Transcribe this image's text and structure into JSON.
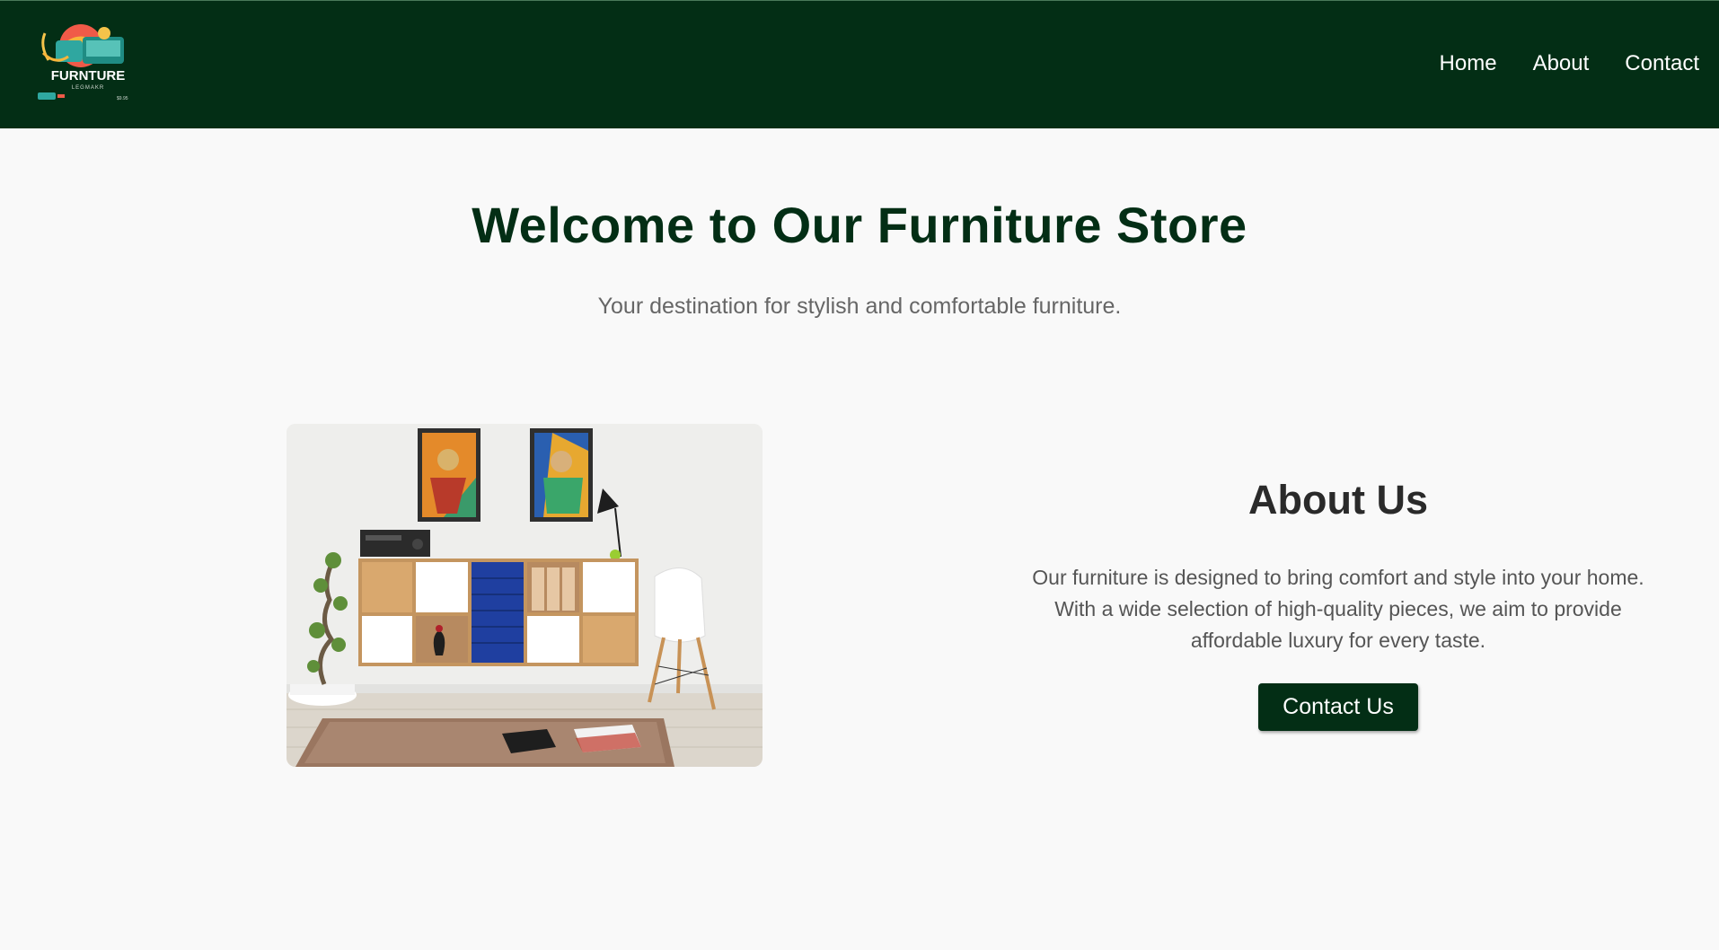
{
  "header": {
    "logo": {
      "brand_text": "FURNTURE",
      "tagline": "LEGMAKR",
      "small_text": "$9.95"
    },
    "nav": [
      "Home",
      "About",
      "Contact"
    ]
  },
  "hero": {
    "title": "Welcome to Our Furniture Store",
    "subtitle": "Your destination for stylish and comfortable furniture."
  },
  "about": {
    "heading": "About Us",
    "body": "Our furniture is designed to bring comfort and style into your home. With a wide selection of high-quality pieces, we aim to provide affordable luxury for every taste.",
    "cta_label": "Contact Us"
  },
  "colors": {
    "header_bg": "#032e15",
    "title": "#032e15",
    "button_bg": "#032e15",
    "page_bg": "#f9f9f9"
  }
}
